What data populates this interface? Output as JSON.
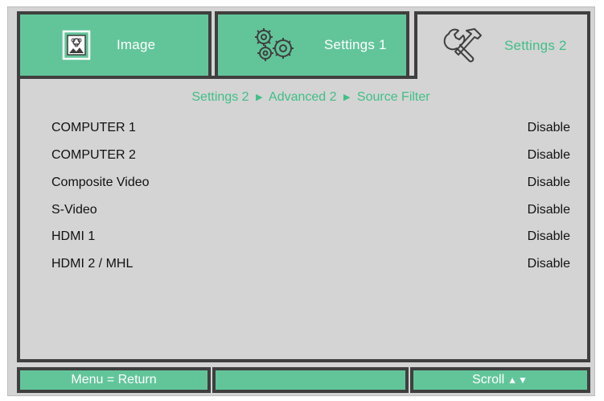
{
  "tabs": [
    {
      "label": "Image",
      "icon": "image-icon",
      "active": false
    },
    {
      "label": "Settings 1",
      "icon": "gears-icon",
      "active": false
    },
    {
      "label": "Settings 2",
      "icon": "tools-icon",
      "active": true
    }
  ],
  "breadcrumb": {
    "part1": "Settings 2",
    "part2": "Advanced 2",
    "part3": "Source Filter",
    "separator": "▶"
  },
  "rows": [
    {
      "label": "COMPUTER 1",
      "value": "Disable"
    },
    {
      "label": "COMPUTER 2",
      "value": "Disable"
    },
    {
      "label": "Composite Video",
      "value": "Disable"
    },
    {
      "label": "S-Video",
      "value": "Disable"
    },
    {
      "label": "HDMI 1",
      "value": "Disable"
    },
    {
      "label": "HDMI 2 / MHL",
      "value": "Disable"
    }
  ],
  "footer": {
    "left": "Menu = Return",
    "middle": "",
    "right": "Scroll",
    "right_arrows": "▲▼"
  },
  "colors": {
    "accent_green": "#62c59a",
    "active_text_green": "#3fbf86",
    "panel_gray": "#d4d4d4",
    "border_dark": "#3f3f3f"
  }
}
